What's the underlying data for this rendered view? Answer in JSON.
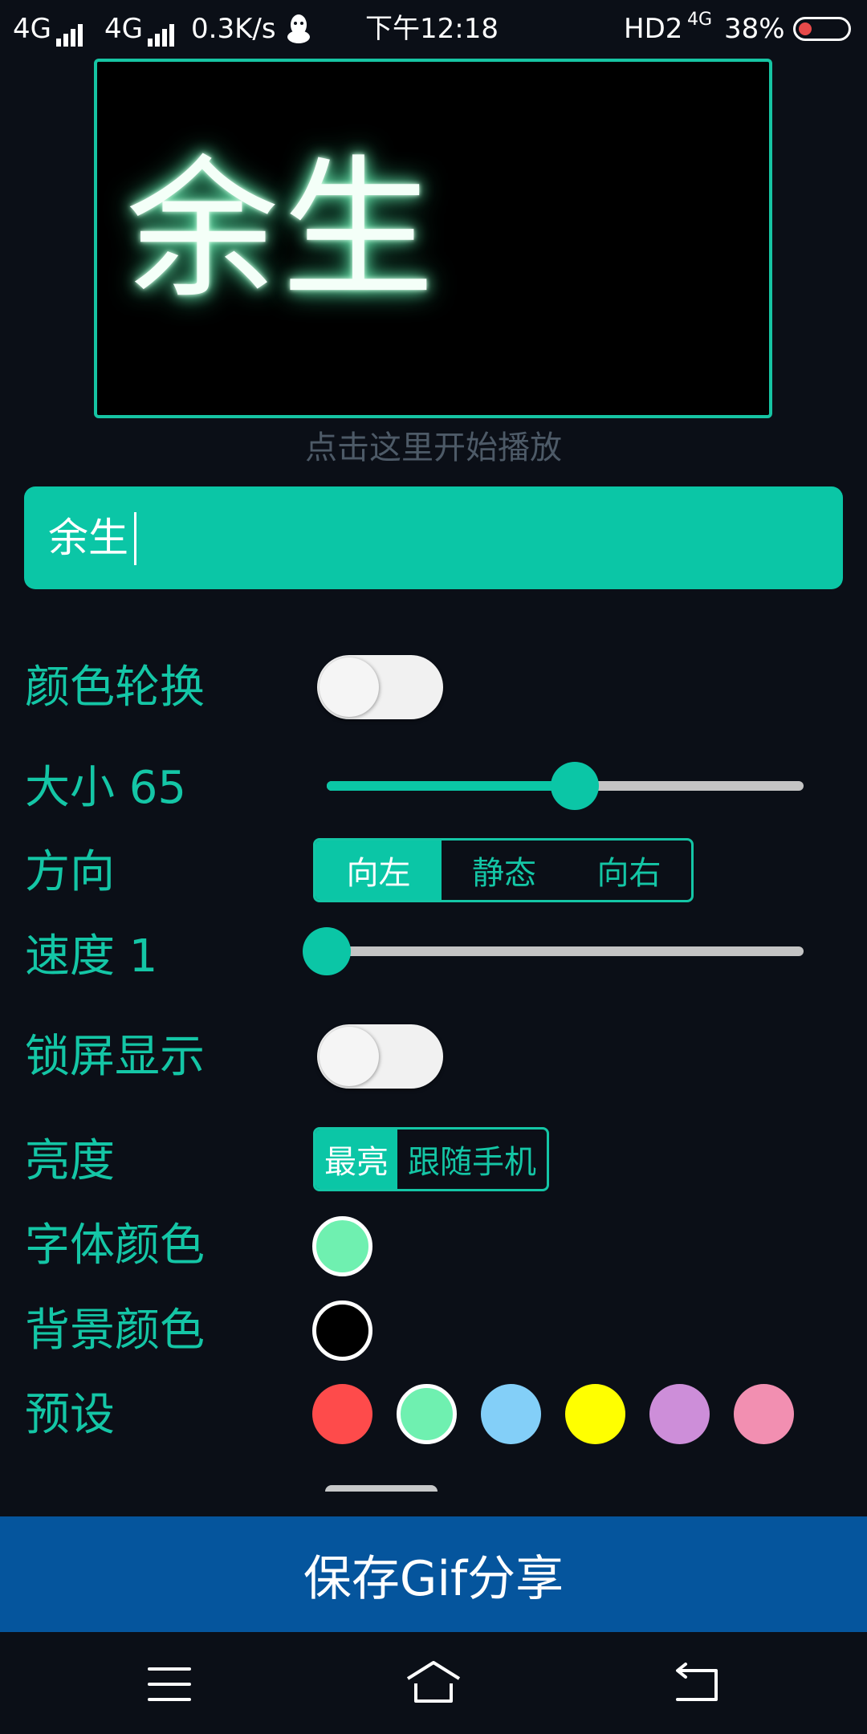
{
  "status_bar": {
    "network1": "4G",
    "network2": "4G",
    "speed": "0.3K/s",
    "time": "下午12:18",
    "hd": "HD2",
    "net_small": "4G",
    "battery": "38%"
  },
  "preview": {
    "text": "余生",
    "hint": "点击这里开始播放",
    "glow_color": "#6ff0b0"
  },
  "input": {
    "value": "余生"
  },
  "settings": {
    "color_cycle": {
      "label": "颜色轮换",
      "on": false
    },
    "size": {
      "label": "大小 65",
      "value": 65,
      "fraction": 0.52
    },
    "direction": {
      "label": "方向",
      "options": [
        "向左",
        "静态",
        "向右"
      ],
      "selected": "向左"
    },
    "speed": {
      "label": "速度 1",
      "value": 1,
      "fraction": 0.0
    },
    "lock_screen": {
      "label": "锁屏显示",
      "on": false
    },
    "brightness": {
      "label": "亮度",
      "options": [
        "最亮",
        "跟随手机"
      ],
      "selected": "最亮"
    },
    "font_color": {
      "label": "字体颜色",
      "color": "#6ff0b0"
    },
    "bg_color": {
      "label": "背景颜色",
      "color": "#000000"
    },
    "presets": {
      "label": "预设",
      "colors": [
        "#fe4b4b",
        "#6ff0b0",
        "#83cff8",
        "#ffff00",
        "#cd8ed9",
        "#f28fb1"
      ]
    }
  },
  "save_button": {
    "label": "保存Gif分享"
  },
  "nav": {
    "menu": "menu-icon",
    "home": "home-icon",
    "back": "back-icon"
  },
  "colors": {
    "accent": "#0bc6a6",
    "background": "#0b0f17",
    "save_bar": "#05559d"
  }
}
